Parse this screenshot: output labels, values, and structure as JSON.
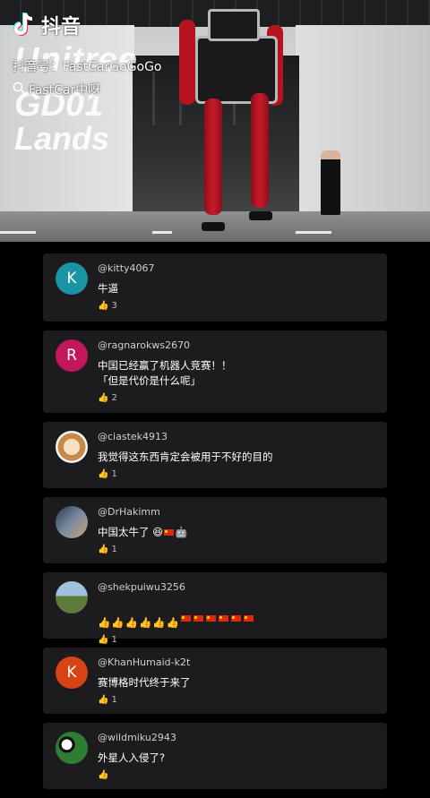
{
  "video": {
    "logo_name": "抖音",
    "account": "抖音号：FastCarGoGoGo",
    "search_tag": "FastCar中呀",
    "overlay_lines": [
      "Unitree",
      "GD01",
      "Lands"
    ]
  },
  "comments": [
    {
      "username": "@kitty4067",
      "text": "牛逼",
      "likes": "3",
      "avatar_letter": "K",
      "avatar_color": "#1a94a3"
    },
    {
      "username": "@ragnarokws2670",
      "text": "中国已经赢了机器人竞赛！！\n「但是代价是什么呢」",
      "likes": "2",
      "avatar_letter": "R",
      "avatar_color": "#c2185b"
    },
    {
      "username": "@ciastek4913",
      "text": "我觉得这东西肯定会被用于不好的目的",
      "likes": "1",
      "avatar_letter": "",
      "avatar_color": "#c58a4a"
    },
    {
      "username": "@DrHakimm",
      "text": "中国太牛了",
      "likes": "1",
      "avatar_letter": "",
      "avatar_color": "#4a5d73"
    },
    {
      "username": "@shekpuiwu3256",
      "text": "",
      "likes": "1",
      "avatar_letter": "",
      "avatar_color": "#5c7a3b"
    },
    {
      "username": "@KhanHumaid-k2t",
      "text": "赛博格时代终于来了",
      "likes": "1",
      "avatar_letter": "K",
      "avatar_color": "#d84315"
    },
    {
      "username": "@wildmiku2943",
      "text": "外星人入侵了?",
      "likes": "",
      "avatar_letter": "",
      "avatar_color": "#2e7d32"
    }
  ],
  "icons": {
    "like": "thumbs-up-icon",
    "search": "search-icon",
    "logo": "tiktok-note-icon"
  }
}
